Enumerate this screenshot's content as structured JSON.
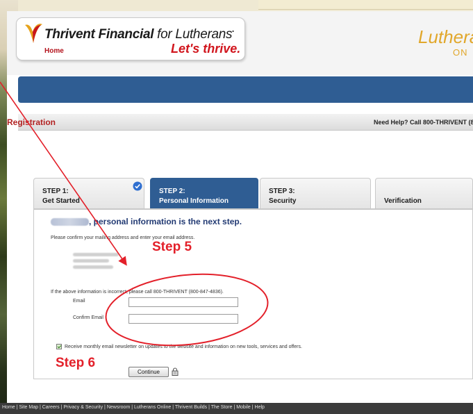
{
  "colors": {
    "brand_blue": "#2f5d93",
    "brand_red": "#d1151d",
    "gold": "#e1a72b",
    "annotation_red": "#e3202a",
    "step_active": "#2f5d93",
    "check_blue": "#2f6fd0"
  },
  "header": {
    "logo_title": "Thrivent Financial",
    "logo_title_suffix": "for Lutherans",
    "home_link": "Home",
    "tagline": "Let's thrive.",
    "right_brand": "Luthera",
    "right_brand_sub": "ON"
  },
  "registration": {
    "title": "Registration",
    "help_text": "Need Help? Call 800-THRIVENT (80"
  },
  "steps": [
    {
      "number": "STEP 1:",
      "name": "Get Started",
      "status": "complete",
      "icon": "check-circle-icon"
    },
    {
      "number": "STEP 2:",
      "name": "Personal Information",
      "status": "active"
    },
    {
      "number": "STEP 3:",
      "name": "Security",
      "status": "upcoming"
    },
    {
      "number": "",
      "name": "Verification",
      "status": "upcoming"
    }
  ],
  "form": {
    "heading": ", personal information is the next step.",
    "instruction": "Please confirm your mailing address and enter your email address.",
    "incorrect_notice": "If the above information is incorrect, please call 800-THRIVENT (800-847-4836).",
    "email_label": "Email",
    "email_value": "",
    "confirm_email_label": "Confirm Email",
    "confirm_email_value": "",
    "newsletter_label": "Receive monthly email newsletter on updates to the website and information on new tools, services and offers.",
    "newsletter_checked": true,
    "continue_label": "Continue"
  },
  "annotations": {
    "step5": "Step 5",
    "step6": "Step 6"
  },
  "footer": {
    "links": "Home  |  Site Map  |  Careers  |  Privacy & Security  |  Newsroom  |  Lutherans Online  |  Thrivent Builds  |  The Store  |  Mobile  |  Help"
  }
}
